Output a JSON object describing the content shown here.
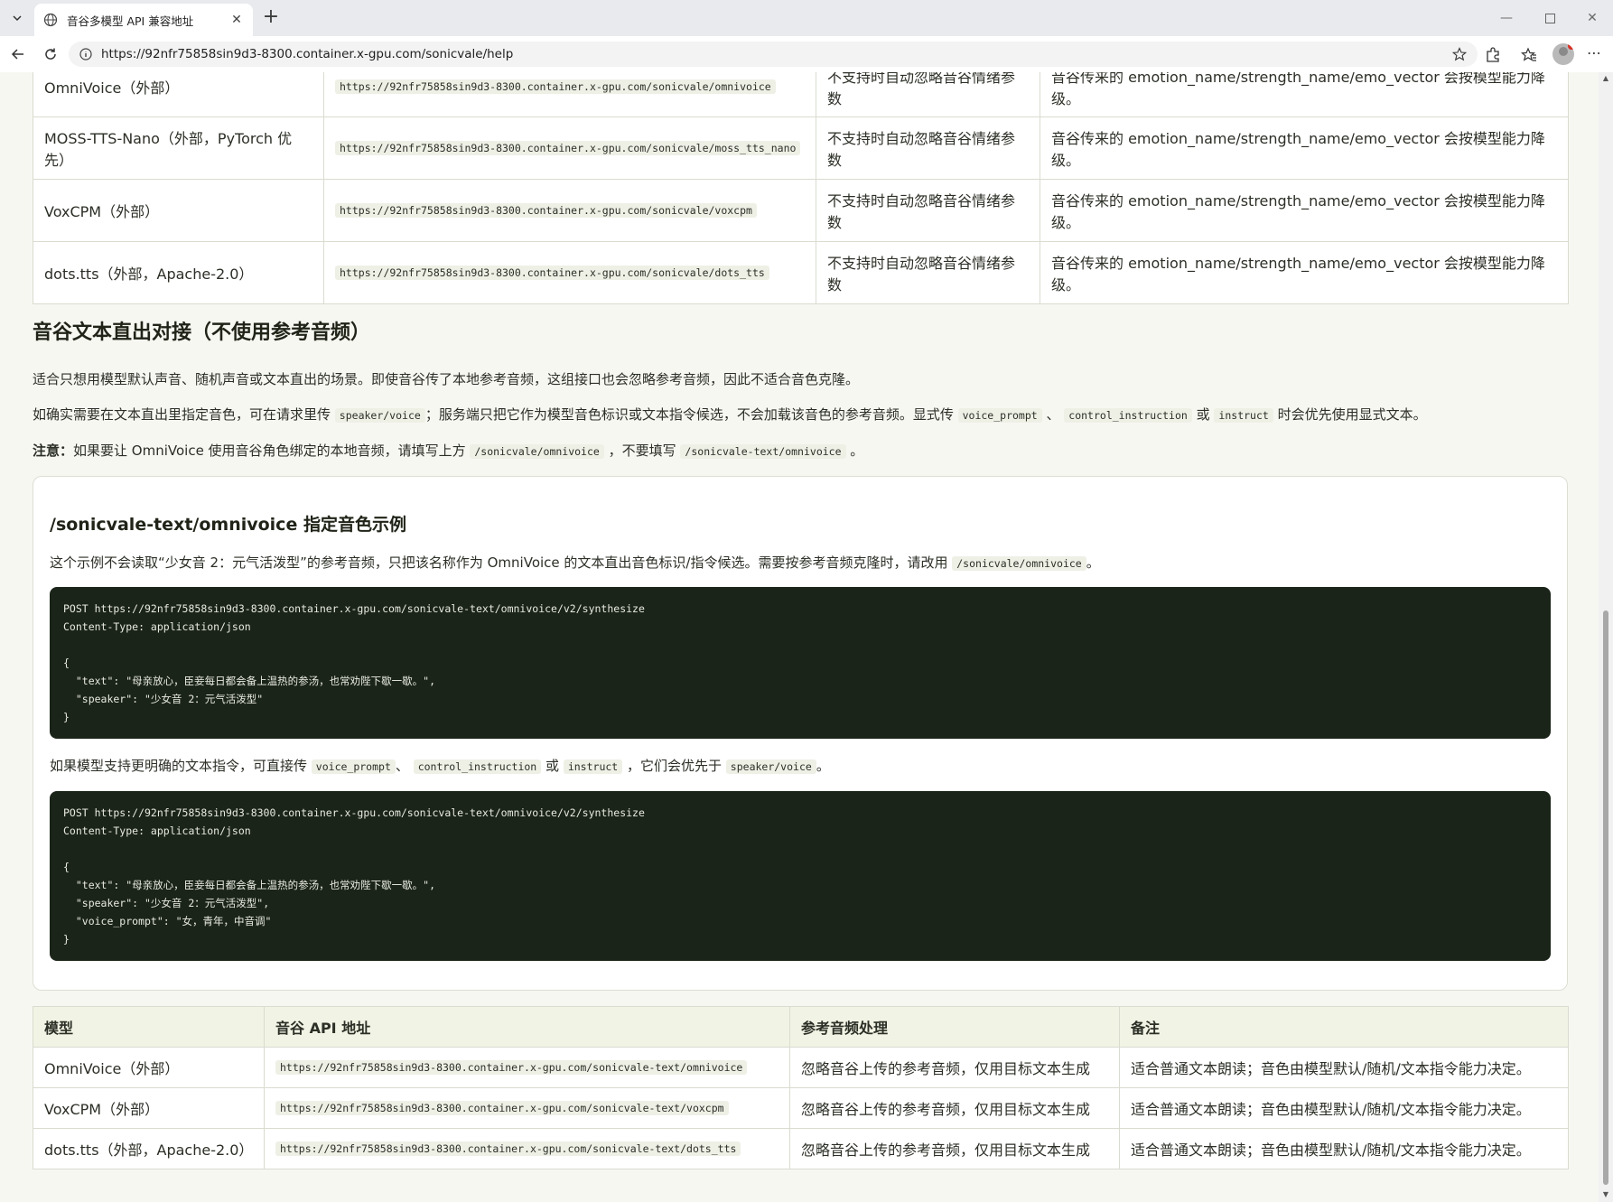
{
  "browser": {
    "tab_title": "音谷多模型 API 兼容地址",
    "url": "https://92nfr75858sin9d3-8300.container.x-gpu.com/sonicvale/help"
  },
  "top_table": {
    "rows": [
      {
        "model": "OmniVoice（外部）",
        "url": "https://92nfr75858sin9d3-8300.container.x-gpu.com/sonicvale/omnivoice",
        "handling": "不支持时自动忽略音谷情绪参数",
        "note": "音谷传来的 emotion_name/strength_name/emo_vector 会按模型能力降级。"
      },
      {
        "model": "MOSS-TTS-Nano（外部，PyTorch 优先）",
        "url": "https://92nfr75858sin9d3-8300.container.x-gpu.com/sonicvale/moss_tts_nano",
        "handling": "不支持时自动忽略音谷情绪参数",
        "note": "音谷传来的 emotion_name/strength_name/emo_vector 会按模型能力降级。"
      },
      {
        "model": "VoxCPM（外部）",
        "url": "https://92nfr75858sin9d3-8300.container.x-gpu.com/sonicvale/voxcpm",
        "handling": "不支持时自动忽略音谷情绪参数",
        "note": "音谷传来的 emotion_name/strength_name/emo_vector 会按模型能力降级。"
      },
      {
        "model": "dots.tts（外部，Apache-2.0）",
        "url": "https://92nfr75858sin9d3-8300.container.x-gpu.com/sonicvale/dots_tts",
        "handling": "不支持时自动忽略音谷情绪参数",
        "note": "音谷传来的 emotion_name/strength_name/emo_vector 会按模型能力降级。"
      }
    ]
  },
  "section": {
    "title": "音谷文本直出对接（不使用参考音频）",
    "p1": "适合只想用模型默认声音、随机声音或文本直出的场景。即使音谷传了本地参考音频，这组接口也会忽略参考音频，因此不适合音色克隆。",
    "p2_a": "如确实需要在文本直出里指定音色，可在请求里传",
    "p2_code1": "speaker/voice",
    "p2_b": "；服务端只把它作为模型音色标识或文本指令候选，不会加载该音色的参考音频。显式传",
    "p2_code2": "voice_prompt",
    "p2_sep": "、",
    "p2_code3": "control_instruction",
    "p2_or": "或",
    "p2_code4": "instruct",
    "p2_c": "时会优先使用显式文本。",
    "note_label": "注意：",
    "note_a": "如果要让 OmniVoice 使用音谷角色绑定的本地音频，请填写上方",
    "note_code1": "/sonicvale/omnivoice",
    "note_b": "，不要填写",
    "note_code2": "/sonicvale-text/omnivoice",
    "note_c": "。"
  },
  "card": {
    "title": "/sonicvale-text/omnivoice 指定音色示例",
    "desc_a": "这个示例不会读取“少女音 2：元气活泼型”的参考音频，只把该名称作为 OmniVoice 的文本直出音色标识/指令候选。需要按参考音频克隆时，请改用",
    "desc_code": "/sonicvale/omnivoice",
    "desc_b": "。",
    "code1": "POST https://92nfr75858sin9d3-8300.container.x-gpu.com/sonicvale-text/omnivoice/v2/synthesize\nContent-Type: application/json\n\n{\n  \"text\": \"母亲放心，臣妾每日都会备上温热的参汤，也常劝陛下歇一歇。\",\n  \"speaker\": \"少女音 2：元气活泼型\"\n}",
    "mid_a": "如果模型支持更明确的文本指令，可直接传",
    "mid_code1": "voice_prompt",
    "mid_sep": "、",
    "mid_code2": "control_instruction",
    "mid_or": "或",
    "mid_code3": "instruct",
    "mid_b": "，它们会优先于",
    "mid_code4": "speaker/voice",
    "mid_c": "。",
    "code2": "POST https://92nfr75858sin9d3-8300.container.x-gpu.com/sonicvale-text/omnivoice/v2/synthesize\nContent-Type: application/json\n\n{\n  \"text\": \"母亲放心，臣妾每日都会备上温热的参汤，也常劝陛下歇一歇。\",\n  \"speaker\": \"少女音 2：元气活泼型\",\n  \"voice_prompt\": \"女，青年，中音调\"\n}"
  },
  "bottom_table": {
    "headers": [
      "模型",
      "音谷 API 地址",
      "参考音频处理",
      "备注"
    ],
    "rows": [
      {
        "model": "OmniVoice（外部）",
        "url": "https://92nfr75858sin9d3-8300.container.x-gpu.com/sonicvale-text/omnivoice",
        "handling": "忽略音谷上传的参考音频，仅用目标文本生成",
        "note": "适合普通文本朗读；音色由模型默认/随机/文本指令能力决定。"
      },
      {
        "model": "VoxCPM（外部）",
        "url": "https://92nfr75858sin9d3-8300.container.x-gpu.com/sonicvale-text/voxcpm",
        "handling": "忽略音谷上传的参考音频，仅用目标文本生成",
        "note": "适合普通文本朗读；音色由模型默认/随机/文本指令能力决定。"
      },
      {
        "model": "dots.tts（外部，Apache-2.0）",
        "url": "https://92nfr75858sin9d3-8300.container.x-gpu.com/sonicvale-text/dots_tts",
        "handling": "忽略音谷上传的参考音频，仅用目标文本生成",
        "note": "适合普通文本朗读；音色由模型默认/随机/文本指令能力决定。"
      }
    ]
  }
}
